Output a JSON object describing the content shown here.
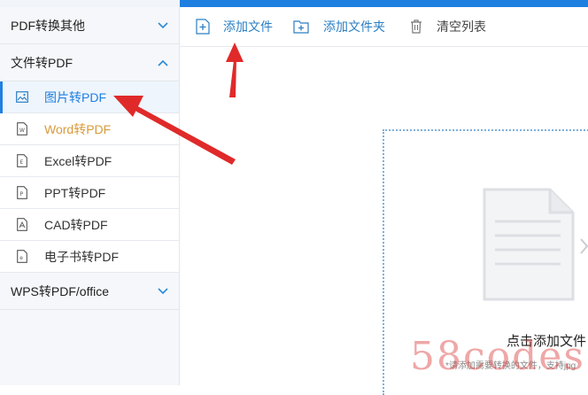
{
  "sidebar": {
    "group1": {
      "title": "PDF转换其他"
    },
    "group2": {
      "title": "文件转PDF"
    },
    "items": [
      {
        "label": "图片转PDF",
        "icon": "image-icon"
      },
      {
        "label": "Word转PDF",
        "icon": "word-file-icon"
      },
      {
        "label": "Excel转PDF",
        "icon": "excel-file-icon"
      },
      {
        "label": "PPT转PDF",
        "icon": "ppt-file-icon"
      },
      {
        "label": "CAD转PDF",
        "icon": "pdf-file-icon"
      },
      {
        "label": "电子书转PDF",
        "icon": "ebook-file-icon"
      }
    ],
    "group3": {
      "title": "WPS转PDF/office"
    }
  },
  "toolbar": {
    "add_file": "添加文件",
    "add_folder": "添加文件夹",
    "clear_list": "清空列表"
  },
  "drop_area": {
    "main_text": "点击添加文件",
    "hint_text": "*请添加需要转换的文件，支持jpg"
  },
  "watermark": "58codes",
  "colors": {
    "accent": "#1f7fe0",
    "word_label": "#d89a3a",
    "annotation_arrow": "#e02a2a"
  }
}
